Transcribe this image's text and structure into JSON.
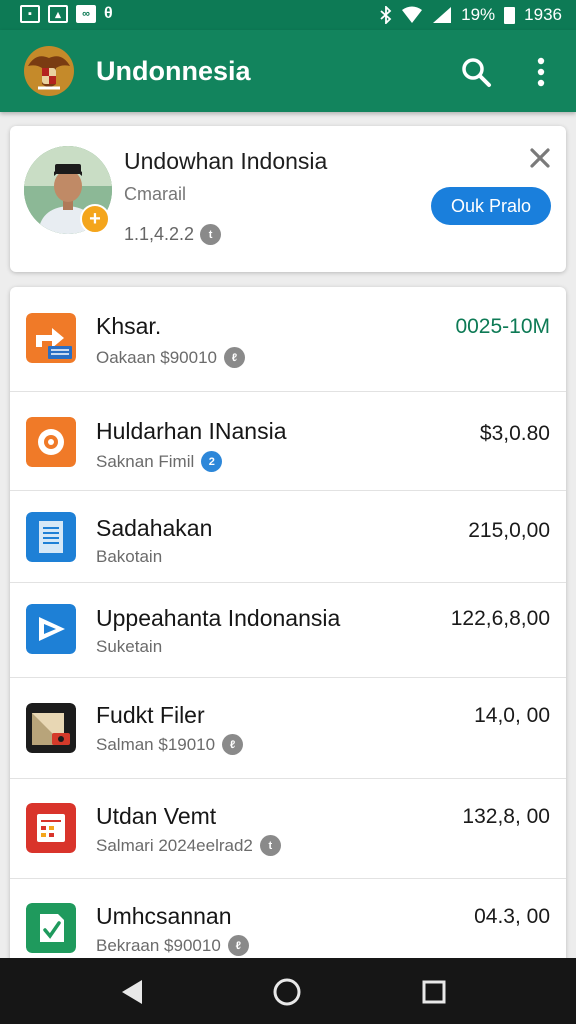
{
  "status_bar": {
    "left_icons": [
      "photo-icon",
      "image-icon",
      "voicemail-icon",
      "data-icon"
    ],
    "battery_text": "19%",
    "time": "1936"
  },
  "app_bar": {
    "title": "Undonnesia",
    "logo_icon": "garuda-emblem-icon",
    "search_icon": "search-icon",
    "more_icon": "more-vert-icon",
    "color": "#12845d"
  },
  "profile_card": {
    "name": "Undowhan Indonsia",
    "subtitle": "Cmarail",
    "count": "1.1,4.2.2",
    "action_label": "Ouk Pralo",
    "close_icon": "close-icon",
    "badge_icon": "plus-icon"
  },
  "list": [
    {
      "title": "Khsar.",
      "subtitle": "Oakaan $90010",
      "amount": "0025-10M",
      "amount_color": "#0d7a55",
      "icon": "transfer-app-icon",
      "icon_color": "#f07a28",
      "tag": "ℓ"
    },
    {
      "title": "Huldarhan INansia",
      "subtitle": "Saknan Fimil",
      "amount": "$3,0.80",
      "icon": "gear-app-icon",
      "icon_color": "#f07a28",
      "tag": "2"
    },
    {
      "title": "Sadahakan",
      "subtitle": "Bakotain",
      "amount": "215,0,00",
      "icon": "document-app-icon",
      "icon_color": "#1e80d6"
    },
    {
      "title": "Uppeahanta Indonansia",
      "subtitle": "Suketain",
      "amount": "122,6,8,00",
      "icon": "play-app-icon",
      "icon_color": "#1e80d6"
    },
    {
      "title": "Fudkt Filer",
      "subtitle": "Salman $19010",
      "amount": "14,0, 00",
      "icon": "film-app-icon",
      "icon_color": "#1c1c1c",
      "tag": "ℓ"
    },
    {
      "title": "Utdan Vemt",
      "subtitle": "Salmari 2024eelrad2",
      "amount": "132,8, 00",
      "icon": "calendar-app-icon",
      "icon_color": "#d9342b",
      "tag": "t"
    },
    {
      "title": "Umhcsannan",
      "subtitle": "Bekraan $90010",
      "amount": "04.3, 00",
      "icon": "check-app-icon",
      "icon_color": "#1f9a5d",
      "tag": "ℓ"
    }
  ],
  "nav_bar": {
    "back_icon": "back-triangle-icon",
    "home_icon": "home-circle-icon",
    "recents_icon": "recents-square-icon"
  }
}
